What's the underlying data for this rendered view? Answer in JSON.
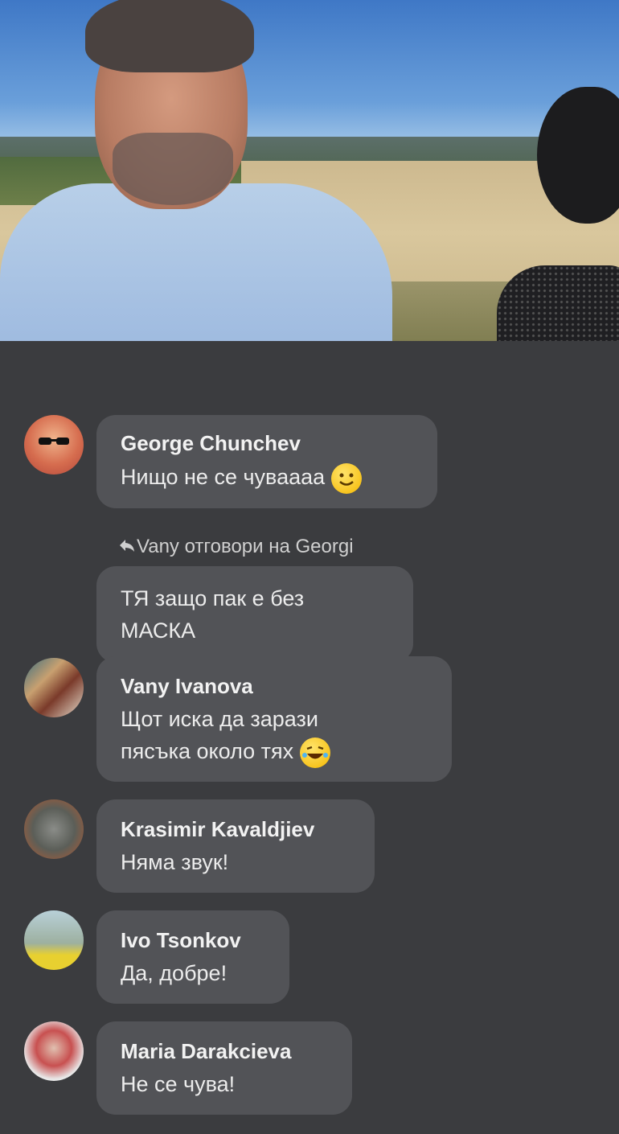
{
  "video": {
    "description_icons": [
      "person-icon",
      "person-icon"
    ]
  },
  "comments": [
    {
      "name": "George Chunchev",
      "text": "Нищо не се чуваааа",
      "emoji": "slightly-smiling-face-icon"
    },
    {
      "reply_header": "Vany отговори на Georgi",
      "text": "ТЯ защо пак е без\nМАСКА"
    },
    {
      "name": "Vany Ivanova",
      "text_line1": "Щот иска да зарази",
      "text_line2": "пясъка около тях",
      "emoji": "rolling-on-floor-laughing-icon"
    },
    {
      "name": "Krasimir Kavaldjiev",
      "text": "Няма звук!"
    },
    {
      "name": "Ivo Tsonkov",
      "text": "Да, добре!"
    },
    {
      "name": "Maria Darakcieva",
      "text": "Не се чува!"
    }
  ],
  "colors": {
    "background": "#3b3c3f",
    "bubble": "#525357",
    "text": "#ececec"
  }
}
